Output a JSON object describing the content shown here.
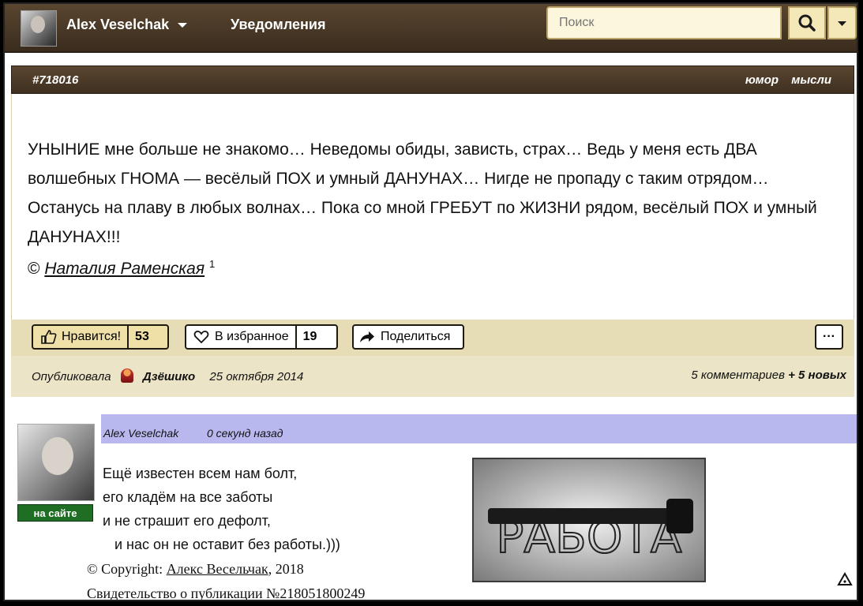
{
  "topbar": {
    "user_name": "Alex Veselchak",
    "notifications_label": "Уведомления",
    "search_placeholder": "Поиск"
  },
  "post": {
    "id": "#718016",
    "tags": [
      "юмор",
      "мысли"
    ],
    "text": "УНЫНИЕ мне больше не знакомо… Неведомы обиды, зависть, страх… Ведь у меня есть ДВА волшебных ГНОМА — весёлый ПОХ и умный ДАНУНАХ… Нигде не пропаду с таким отрядом… Останусь на плаву в любых волнах… Пока со мной ГРЕБУТ по ЖИЗНИ рядом, весёлый ПОХ и умный ДАНУНАХ!!!",
    "copyright_sign": "©",
    "author": "Наталия Раменская",
    "author_sup": "1"
  },
  "actions": {
    "like_label": "Нравится!",
    "like_count": "53",
    "fav_label": "В избранное",
    "fav_count": "19",
    "share_label": "Поделиться",
    "more_label": "···"
  },
  "meta": {
    "published_label": "Опубликовала",
    "publisher": "Дзёшико",
    "date": "25 октября 2014",
    "comments": "5 комментариев",
    "new_comments": "+ 5 новых"
  },
  "comment": {
    "author": "Alex Veselchak",
    "time": "0 секунд назад",
    "status": "на сайте",
    "poem": [
      "Ещё известен всем нам болт,",
      "его кладём на все заботы",
      "и не страшит его дефолт,",
      "   и нас он не оставит без работы.)))"
    ],
    "copyright_prefix": "© Copyright:",
    "copyright_author": "Алекс Весельчак",
    "copyright_year": ", 2018",
    "certificate": "Свидетельство о публикации №218051800249",
    "image_word": "РАБОТА"
  }
}
